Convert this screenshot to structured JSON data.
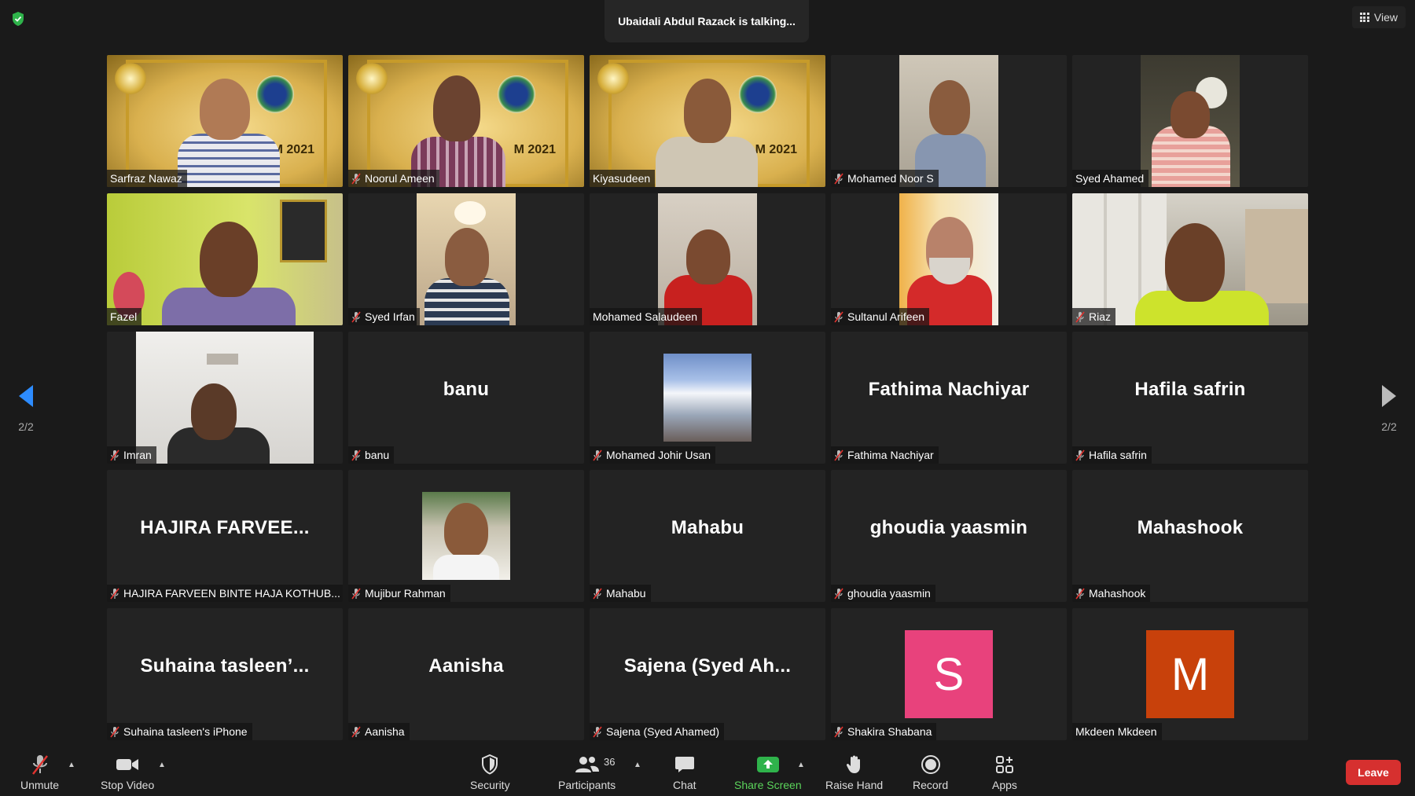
{
  "status": {
    "talking": "Ubaidali Abdul Razack is talking..."
  },
  "view_button": {
    "label": "View",
    "icon": "grid-icon"
  },
  "paging": {
    "left": "2/2",
    "right": "2/2"
  },
  "participants": [
    {
      "name": "Sarfraz Nawaz",
      "kind": "video",
      "muted": false
    },
    {
      "name": "Noorul Ameen",
      "kind": "video",
      "muted": true
    },
    {
      "name": "Kiyasudeen",
      "kind": "video",
      "muted": false
    },
    {
      "name": "Mohamed Noor S",
      "kind": "video",
      "muted": true
    },
    {
      "name": "Syed Ahamed",
      "kind": "video",
      "muted": false
    },
    {
      "name": "Fazel",
      "kind": "video",
      "muted": false
    },
    {
      "name": "Syed Irfan",
      "kind": "video",
      "muted": true
    },
    {
      "name": "Mohamed Salaudeen",
      "kind": "video",
      "muted": false
    },
    {
      "name": "Sultanul Arifeen",
      "kind": "video",
      "muted": true
    },
    {
      "name": "Riaz",
      "kind": "video",
      "muted": true
    },
    {
      "name": "Imran",
      "kind": "video",
      "muted": true
    },
    {
      "name": "banu",
      "kind": "name",
      "display": "banu",
      "muted": true
    },
    {
      "name": "Mohamed Johir Usan",
      "kind": "picture",
      "muted": true
    },
    {
      "name": "Fathima Nachiyar",
      "kind": "name",
      "display": "Fathima Nachiyar",
      "muted": true
    },
    {
      "name": "Hafila safrin",
      "kind": "name",
      "display": "Hafila safrin",
      "muted": true
    },
    {
      "name": "HAJIRA FARVEEN BINTE HAJA KOTHUB...",
      "kind": "name",
      "display": "HAJIRA  FARVEE...",
      "muted": true
    },
    {
      "name": "Mujibur Rahman",
      "kind": "picture",
      "muted": true
    },
    {
      "name": "Mahabu",
      "kind": "name",
      "display": "Mahabu",
      "muted": true
    },
    {
      "name": "ghoudia yaasmin",
      "kind": "name",
      "display": "ghoudia yaasmin",
      "muted": true
    },
    {
      "name": "Mahashook",
      "kind": "name",
      "display": "Mahashook",
      "muted": true
    },
    {
      "name": "Suhaina tasleen's iPhone",
      "kind": "name",
      "display": "Suhaina  tasleen’...",
      "muted": true
    },
    {
      "name": "Aanisha",
      "kind": "name",
      "display": "Aanisha",
      "muted": true
    },
    {
      "name": "Sajena (Syed Ahamed)",
      "kind": "name",
      "display": "Sajena  (Syed Ah...",
      "muted": true
    },
    {
      "name": "Shakira Shabana",
      "kind": "letter",
      "letter": "S",
      "color": "#e8427c",
      "muted": true
    },
    {
      "name": "Mkdeen Mkdeen",
      "kind": "letter",
      "letter": "M",
      "color": "#c8410b",
      "muted": false
    }
  ],
  "toolbar": {
    "unmute": "Unmute",
    "stop_video": "Stop Video",
    "security": "Security",
    "participants": "Participants",
    "participants_count": "36",
    "chat": "Chat",
    "share_screen": "Share Screen",
    "raise_hand": "Raise Hand",
    "record": "Record",
    "apps": "Apps",
    "leave": "Leave"
  },
  "colors": {
    "background": "#1a1a1a",
    "tile": "#232323",
    "share_green": "#5bd45b",
    "leave_red": "#d6302f",
    "accent_blue": "#2d8cff"
  }
}
